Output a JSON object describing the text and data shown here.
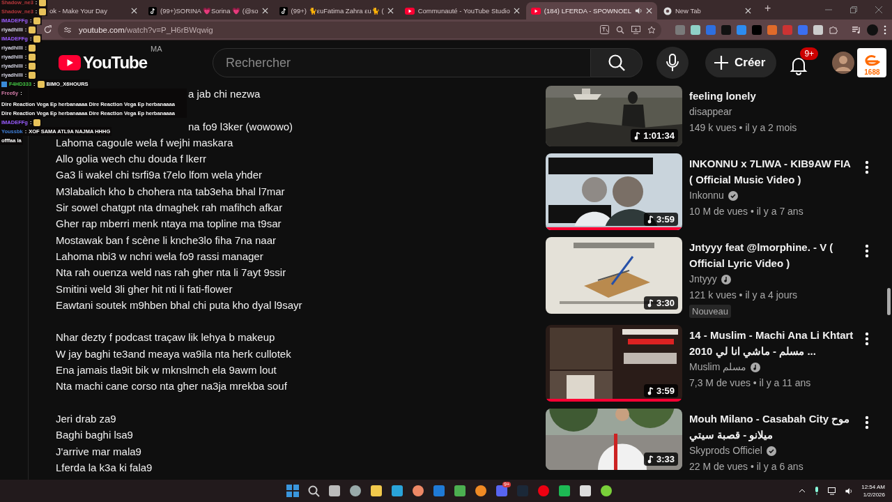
{
  "browser": {
    "tabs": [
      {
        "title": "ok - Make Your Day",
        "kind": "plain",
        "audio": false,
        "selected": false
      },
      {
        "title": "(99+)SORINA 💗Sorina 💗 (@so",
        "kind": "tiktok",
        "audio": false,
        "selected": false
      },
      {
        "title": "(99+) 🐈εuFatima Zahra εu🐈 (",
        "kind": "tiktok",
        "audio": false,
        "selected": false
      },
      {
        "title": "Communauté - YouTube Studio",
        "kind": "youtube",
        "audio": false,
        "selected": false
      },
      {
        "title": "(184) LFERDA - SPOWNOEL",
        "kind": "youtube",
        "audio": true,
        "selected": true
      },
      {
        "title": "New Tab",
        "kind": "chrome",
        "audio": false,
        "selected": false
      }
    ],
    "new_tab": "+",
    "url_host": "youtube.com",
    "url_path": "/watch?v=P_H6rBWqwig"
  },
  "chat_separator": ":",
  "chat": [
    {
      "user": "Shadow_ne3",
      "color": "#b8383c",
      "emote": true
    },
    {
      "user": "Shadow_ne3",
      "color": "#b8383c",
      "emote": true
    },
    {
      "user": "IMADEFFg",
      "color": "#9a5cff",
      "emote": true
    },
    {
      "user": "riyadhilli",
      "color": "#d8d8e8",
      "emote": true
    },
    {
      "user": "IMADEFFg",
      "color": "#9a5cff",
      "emote": true
    },
    {
      "user": "riyadhilli",
      "color": "#d8d8e8",
      "emote": true
    },
    {
      "user": "riyadhilli",
      "color": "#d8d8e8",
      "emote": true
    },
    {
      "user": "riyadhilli",
      "color": "#d8d8e8",
      "emote": true
    },
    {
      "user": "riyadhilli",
      "color": "#d8d8e8",
      "emote": true
    },
    {
      "user": "F4HD333",
      "color": "#43c443",
      "badge": true,
      "emote": true,
      "message": "BIMO_X6HOURS"
    },
    {
      "user": "Free6y",
      "color": "#d07aa6",
      "emote": false,
      "message": "Dire Reaction Vega Ep herbanaaaa Dire Reaction Vega Ep herbanaaaa Dire Reaction Vega Ep herbanaaaa Dire Reaction Vega Ep herbanaaaa"
    },
    {
      "user": "IMADEFFg",
      "color": "#9a5cff",
      "emote": true
    },
    {
      "user": "Youssbk",
      "color": "#3f7fd8",
      "emote": false,
      "message": "XOF SAMA ATL9A NAJMA HHHG"
    },
    {
      "emote": false,
      "message": "offfaa la"
    }
  ],
  "header": {
    "logo_text": "YouTube",
    "country": "MA",
    "search_placeholder": "Rechercher",
    "create_label": "Créer",
    "notification_count": "9+",
    "widget_label": "1688"
  },
  "lyrics": [
    [
      {
        "kind": "cut",
        "text": "a jab chi nezwa"
      }
    ],
    [
      {
        "kind": "cut",
        "text": "na fo9 l3ker (wowowo)"
      },
      {
        "kind": "line",
        "text": "Lahoma cagoule wela f wejhi maskara"
      },
      {
        "kind": "line",
        "text": "Allo golia wech chu douda f lkerr"
      },
      {
        "kind": "line",
        "text": "Ga3 li wakel chi tsrfi9a t7elo lfom wela yhder"
      },
      {
        "kind": "line",
        "text": "M3labalich kho b chohera nta tab3eha bhal l7mar"
      },
      {
        "kind": "line",
        "text": "Sir sowel chatgpt nta dmaghek rah mafihch afkar"
      },
      {
        "kind": "line",
        "text": "Gher rap mberri menk ntaya ma topline ma t9sar"
      },
      {
        "kind": "line",
        "text": "Mostawak ban f scène li knche3lo fiha 7na naar"
      },
      {
        "kind": "line",
        "text": "Lahoma nbi3 w nchri wela fo9 rassi manager"
      },
      {
        "kind": "line",
        "text": "Nta rah ouenza weld nas rah gher nta li 7ayt 9ssir"
      },
      {
        "kind": "line",
        "text": "Smitini weld 3li gher hit nti li fati-flower"
      },
      {
        "kind": "line",
        "text": "Eawtani soutek m9hben bhal chi puta kho dyal l9sayr"
      }
    ],
    [
      {
        "kind": "line",
        "text": "Nhar dezty f podcast traçaw lik lehya b makeup"
      },
      {
        "kind": "line",
        "text": "W jay baghi te3and meaya wa9ila nta herk cullotek"
      },
      {
        "kind": "line",
        "text": "Ena jamais tla9it bik w mknslmch ela 9awm lout"
      },
      {
        "kind": "line",
        "text": "Nta machi cane corso nta gher na3ja mrekba souf"
      }
    ],
    [
      {
        "kind": "line",
        "text": "Jeri drab za9"
      },
      {
        "kind": "line",
        "text": "Baghi baghi lsa9"
      },
      {
        "kind": "line",
        "text": "J'arrive mar mala9"
      },
      {
        "kind": "line",
        "text": "Lferda la k3a ki fala9"
      }
    ]
  ],
  "videos": [
    {
      "kind": "cut_top",
      "title": "feeling lonely",
      "channel": "disappear",
      "meta": "149 k vues • il y a 2 mois",
      "duration": "1:01:34"
    },
    {
      "kind": "full",
      "title": "INKONNU x 7LIWA - KIB9AW FIA ( Official Music Video )",
      "channel": "Inkonnu",
      "badge": {
        "kind": "verified"
      },
      "meta": "10 M de vues • il y a 7 ans",
      "duration": "3:59",
      "level": 1
    },
    {
      "kind": "full",
      "title": "Jntyyy feat @lmorphine.  - V ( Official Lyric Video )",
      "channel": "Jntyyy",
      "badge": {
        "kind": "music"
      },
      "meta": "121 k vues • il y a 4 jours",
      "tag": "Nouveau",
      "duration": "3:30"
    },
    {
      "kind": "full",
      "title": "14 - Muslim -  Machi Ana Li Khtart 2010 مسلم - ماشي انا لي ...",
      "channel": "Muslim مسلم",
      "badge": {
        "kind": "music"
      },
      "meta": "7,3 M de vues • il y a 11 ans",
      "duration": "3:59",
      "level": 1
    },
    {
      "kind": "cut_bottom",
      "title": "Mouh Milano - Casabah City موح ميلانو - قصبة سيتي",
      "channel": "Skyprods Officiel",
      "badge": {
        "kind": "verified"
      },
      "meta": "22 M de vues • il y a 6 ans",
      "duration": "3:33"
    }
  ],
  "taskbar": {
    "discord_badge": "9+",
    "time": "12:54 AM",
    "date": "1/2/2026"
  }
}
